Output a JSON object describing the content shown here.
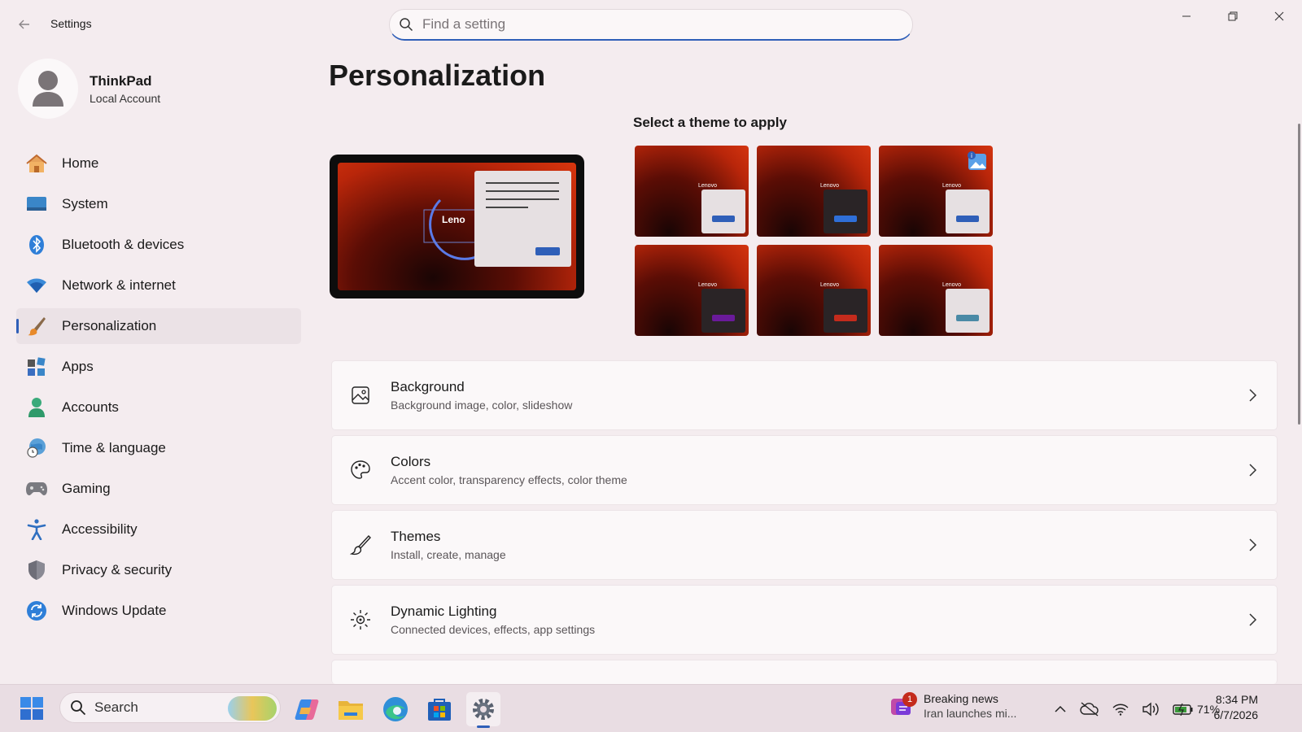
{
  "app": {
    "title": "Settings",
    "search_placeholder": "Find a setting"
  },
  "profile": {
    "name": "ThinkPad",
    "account_type": "Local Account"
  },
  "sidebar": {
    "items": [
      {
        "label": "Home",
        "icon": "home-icon"
      },
      {
        "label": "System",
        "icon": "monitor-icon"
      },
      {
        "label": "Bluetooth & devices",
        "icon": "bluetooth-icon"
      },
      {
        "label": "Network & internet",
        "icon": "wifi-icon"
      },
      {
        "label": "Personalization",
        "icon": "brush-icon",
        "active": true
      },
      {
        "label": "Apps",
        "icon": "apps-icon"
      },
      {
        "label": "Accounts",
        "icon": "person-icon"
      },
      {
        "label": "Time & language",
        "icon": "globe-clock-icon"
      },
      {
        "label": "Gaming",
        "icon": "gamepad-icon"
      },
      {
        "label": "Accessibility",
        "icon": "accessibility-icon"
      },
      {
        "label": "Privacy & security",
        "icon": "shield-icon"
      },
      {
        "label": "Windows Update",
        "icon": "refresh-icon"
      }
    ]
  },
  "main": {
    "title": "Personalization",
    "preview_logo": "Leno",
    "theme_heading": "Select a theme to apply",
    "themes": [
      {
        "window_color": "#e6e0e2",
        "accent": "#2f5fb8",
        "logo": "Lenovo"
      },
      {
        "window_color": "#2a2426",
        "accent": "#2f6fd8",
        "logo": "Lenovo"
      },
      {
        "window_color": "#e6e0e2",
        "accent": "#2f5fb8",
        "logo": "Lenovo",
        "badge": true
      },
      {
        "window_color": "#2a2426",
        "accent": "#6a1a9a",
        "logo": "Lenovo"
      },
      {
        "window_color": "#2a2426",
        "accent": "#c42b1c",
        "logo": "Lenovo"
      },
      {
        "window_color": "#e6e0e2",
        "accent": "#4a8aa6",
        "logo": "Lenovo"
      }
    ],
    "cards": [
      {
        "title": "Background",
        "subtitle": "Background image, color, slideshow",
        "icon": "image-icon"
      },
      {
        "title": "Colors",
        "subtitle": "Accent color, transparency effects, color theme",
        "icon": "palette-icon"
      },
      {
        "title": "Themes",
        "subtitle": "Install, create, manage",
        "icon": "brush-icon"
      },
      {
        "title": "Dynamic Lighting",
        "subtitle": "Connected devices, effects, app settings",
        "icon": "lighting-icon"
      }
    ]
  },
  "taskbar": {
    "search_label": "Search",
    "news_count": "1",
    "news_title": "Breaking news",
    "news_subtitle": "Iran launches mi...",
    "battery_percent": "71%",
    "time": "8:34 PM",
    "date": "6/7/2026"
  },
  "colors": {
    "accent": "#2f5fb8",
    "background": "#f4ecef",
    "card": "#fbf8f9"
  }
}
